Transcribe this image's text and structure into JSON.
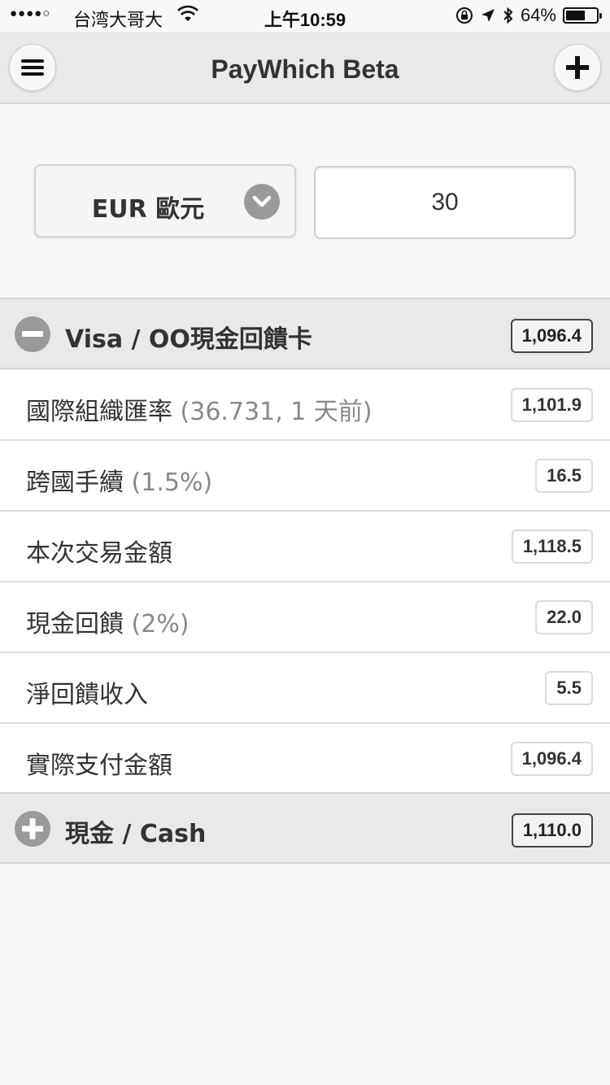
{
  "status_bar": {
    "signal": "●●●●○",
    "carrier": "台湾大哥大",
    "time": "上午10:59",
    "battery_percent": "64%",
    "battery_level": 0.64
  },
  "header": {
    "title": "PayWhich Beta",
    "menu_icon": "hamburger-icon",
    "add_icon": "plus-icon"
  },
  "form": {
    "currency_label": "EUR 歐元",
    "amount_value": "30"
  },
  "card_group": {
    "label": "Visa / OO現金回饋卡",
    "total": "1,096.4",
    "expanded": true,
    "items": [
      {
        "label": "國際組織匯率",
        "detail": " (36.731, 1 天前)",
        "value": "1,101.9"
      },
      {
        "label": "跨國手續",
        "detail": " (1.5%)",
        "value": "16.5"
      },
      {
        "label": "本次交易金額",
        "detail": "",
        "value": "1,118.5"
      },
      {
        "label": "現金回饋",
        "detail": " (2%)",
        "value": "22.0"
      },
      {
        "label": "淨回饋收入",
        "detail": "",
        "value": "5.5"
      },
      {
        "label": "實際支付金額",
        "detail": "",
        "value": "1,096.4"
      }
    ]
  },
  "cash_group": {
    "label": "現金 / Cash",
    "total": "1,110.0",
    "expanded": false
  }
}
